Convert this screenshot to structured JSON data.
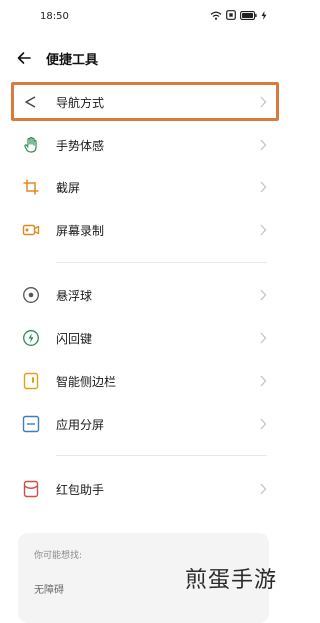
{
  "status": {
    "time": "18:50"
  },
  "header": {
    "title": "便捷工具"
  },
  "items": [
    {
      "label": "导航方式",
      "icon": "navigation-triangle-icon"
    },
    {
      "label": "手势体感",
      "icon": "hand-gesture-icon"
    },
    {
      "label": "截屏",
      "icon": "crop-icon"
    },
    {
      "label": "屏幕录制",
      "icon": "video-record-icon"
    },
    {
      "label": "悬浮球",
      "icon": "floating-ball-icon"
    },
    {
      "label": "闪回键",
      "icon": "flashback-icon"
    },
    {
      "label": "智能侧边栏",
      "icon": "sidebar-icon"
    },
    {
      "label": "应用分屏",
      "icon": "split-screen-icon"
    },
    {
      "label": "红包助手",
      "icon": "red-envelope-icon"
    }
  ],
  "suggest": {
    "header": "你可能想找:",
    "items": [
      "无障碍"
    ]
  },
  "watermark": "煎蛋手游",
  "colors": {
    "icon_green": "#2e8b57",
    "icon_orange": "#e08a1e",
    "highlight": "#d97a3f",
    "text": "#1a1a1a"
  }
}
